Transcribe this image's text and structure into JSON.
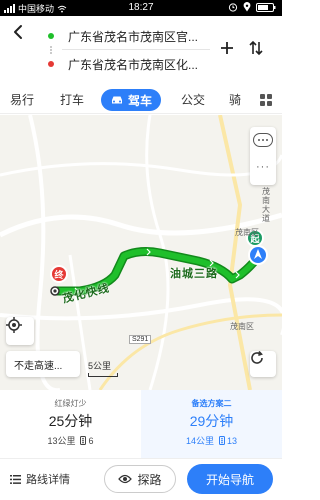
{
  "status_bar": {
    "carrier": "中国移动",
    "time": "18:27"
  },
  "route": {
    "origin": "广东省茂名市茂南区官...",
    "destination": "广东省茂名市茂南区化..."
  },
  "tabs": [
    {
      "label": "易行"
    },
    {
      "label": "打车"
    },
    {
      "label": "驾车"
    },
    {
      "label": "公交"
    },
    {
      "label": "骑"
    }
  ],
  "map": {
    "labels": {
      "district_right": "茂南区",
      "district_bottom": "茂南区",
      "road_badge": "S291",
      "road_side": "茂南大道"
    },
    "route_labels": {
      "left": "茂化快线",
      "right": "油城三路"
    },
    "markers": {
      "start": "起",
      "end": "终"
    },
    "avoid_highway": "不走高速...",
    "scale": "5公里",
    "colors": {
      "route": "#1fbf2b",
      "start_marker": "#1c9c64",
      "end_marker": "#e53935",
      "accent": "#2d7ff9"
    }
  },
  "options": [
    {
      "tag": "红绿灯少",
      "duration": "25分钟",
      "distance": "13公里",
      "lights": "6"
    },
    {
      "tag": "备选方案二",
      "duration": "29分钟",
      "distance": "14公里",
      "lights": "13"
    }
  ],
  "bottom": {
    "details": "路线详情",
    "explore": "探路",
    "start": "开始导航"
  }
}
